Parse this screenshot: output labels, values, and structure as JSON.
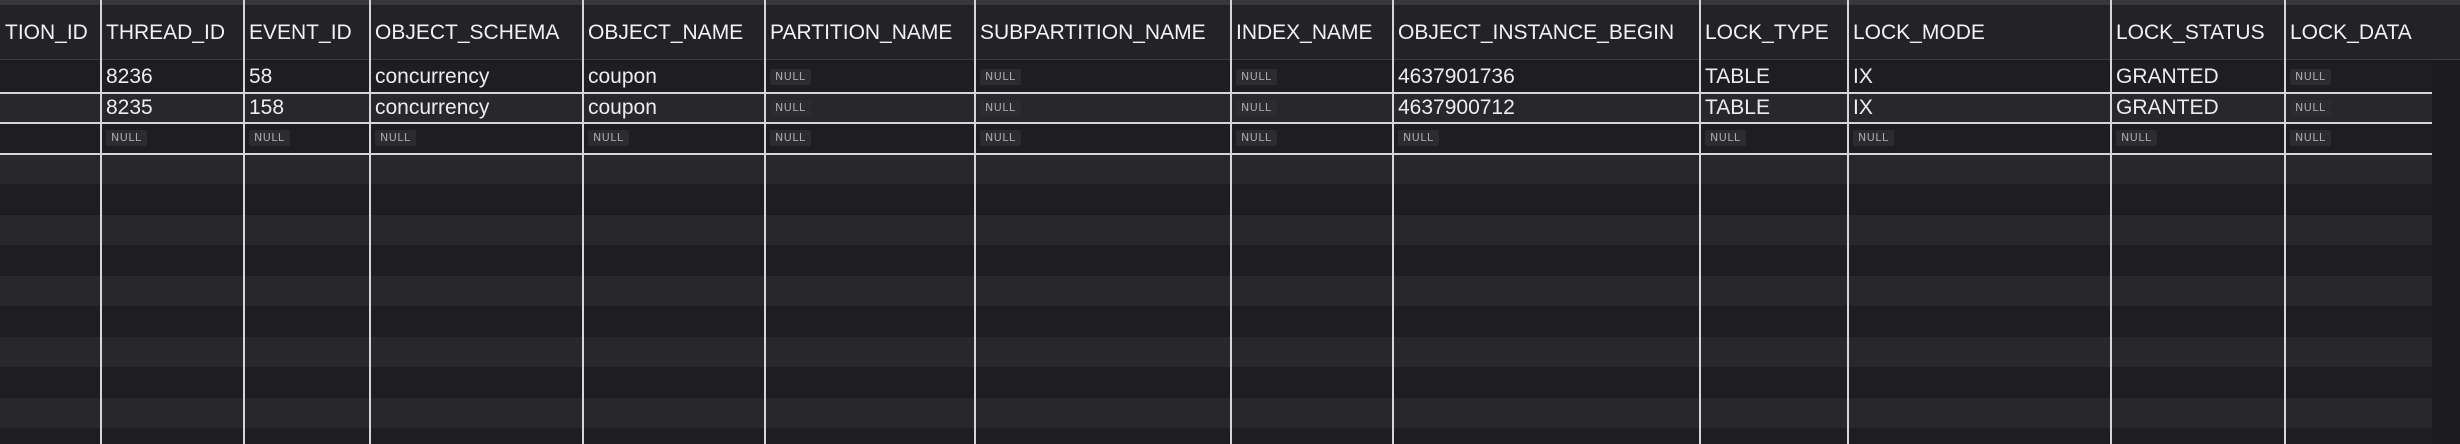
{
  "columns": [
    "TION_ID",
    "THREAD_ID",
    "EVENT_ID",
    "OBJECT_SCHEMA",
    "OBJECT_NAME",
    "PARTITION_NAME",
    "SUBPARTITION_NAME",
    "INDEX_NAME",
    "OBJECT_INSTANCE_BEGIN",
    "LOCK_TYPE",
    "LOCK_MODE",
    "LOCK_STATUS",
    "LOCK_DATA"
  ],
  "null_label": "NULL",
  "rows": [
    [
      "",
      "8236",
      "58",
      "concurrency",
      "coupon",
      null,
      null,
      null,
      "4637901736",
      "TABLE",
      "IX",
      "GRANTED",
      null
    ],
    [
      "",
      "8235",
      "158",
      "concurrency",
      "coupon",
      null,
      null,
      null,
      "4637900712",
      "TABLE",
      "IX",
      "GRANTED",
      null
    ],
    [
      "",
      null,
      null,
      null,
      null,
      null,
      null,
      null,
      null,
      null,
      null,
      null,
      null
    ]
  ],
  "empty_row_count": 10
}
